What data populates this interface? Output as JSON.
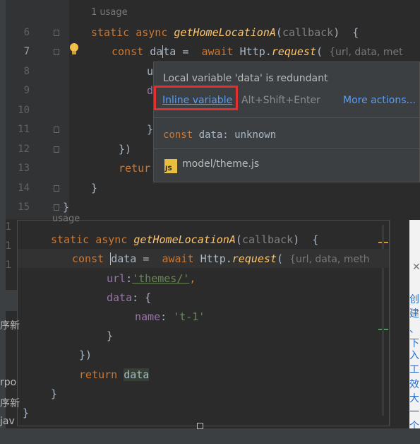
{
  "top": {
    "usage": "1 usage",
    "line_numbers": [
      "6",
      "7",
      "8",
      "9",
      "10",
      "11",
      "12",
      "13",
      "14",
      "15"
    ],
    "line6": {
      "kw1": "static",
      "kw2": "async",
      "fn": "getHomeLocationA",
      "open": "(",
      "param": "callback",
      "close": ")",
      "brace": "{"
    },
    "line7": {
      "kw": "const",
      "var_before": "da",
      "var_after": "ta",
      "eq": "=",
      "await": "await",
      "obj": "Http.",
      "method": "request",
      "paren": "(",
      "hint": "{url, data, met"
    },
    "line8": "u",
    "line9": "d",
    "line11": "}",
    "line12": "})",
    "line13": "retur",
    "line14": "}",
    "line15": "}"
  },
  "popup": {
    "message": "Local variable 'data' is redundant",
    "action": "Inline variable",
    "shortcut": "Alt+Shift+Enter",
    "more": "More actions...",
    "declaration": {
      "kw": "const",
      "rest": "data: unknown"
    },
    "file_badge": "JS",
    "file": "model/theme.js"
  },
  "bottom": {
    "usage": "usage",
    "left_line_numbers": [
      "1",
      "1",
      "1"
    ],
    "line1": {
      "kw1": "static",
      "kw2": "async",
      "fn": "getHomeLocationA",
      "open": "(",
      "param": "callback",
      "close": ")",
      "brace": "{"
    },
    "line2": {
      "kw": "const",
      "var": "data",
      "eq": "=",
      "await": "await",
      "obj": "Http.",
      "method": "request",
      "paren": "(",
      "hint": "{url, data, meth"
    },
    "line3": {
      "key": "url",
      "colon": ":",
      "val": "'themes/'",
      "comma": ","
    },
    "line4": {
      "key": "data",
      "rest": ": {"
    },
    "line5": {
      "key": "name",
      "colon": ": ",
      "val": "'t-1'"
    },
    "line6": "}",
    "line7": "})",
    "line8": {
      "kw": "return",
      "var": "data"
    },
    "line9": "}",
    "line10": "}"
  },
  "side": {
    "left_labels": [
      "序新",
      "rpo",
      "序新",
      "jav"
    ],
    "right_labels": [
      "创建",
      "、下",
      "入工",
      "效大",
      "一个"
    ]
  },
  "colors": {
    "highlight_box": "#e62e2e",
    "link": "#589df6",
    "keyword": "#cc7832",
    "function": "#ffc66d",
    "string": "#6a8759",
    "property": "#9876aa"
  }
}
